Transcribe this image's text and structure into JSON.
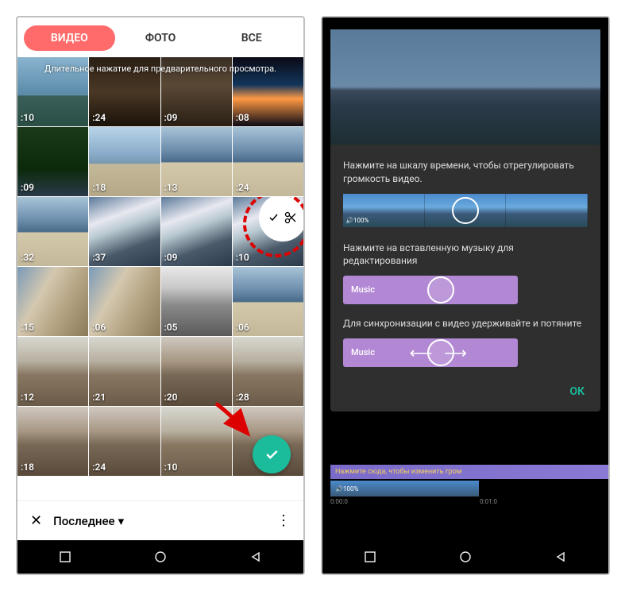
{
  "left": {
    "tabs": {
      "video": "ВИДЕО",
      "photo": "ФОТО",
      "all": "ВСЕ"
    },
    "hint": "Длительное нажатие для предварительного просмотра.",
    "cells": [
      {
        "dur": ":10",
        "cls": "sky1"
      },
      {
        "dur": ":24",
        "cls": "indoor"
      },
      {
        "dur": ":09",
        "cls": "indoor2"
      },
      {
        "dur": ":08",
        "cls": "dark"
      },
      {
        "dur": ":09",
        "cls": "tree"
      },
      {
        "dur": ":18",
        "cls": "beach"
      },
      {
        "dur": ":13",
        "cls": "beach2"
      },
      {
        "dur": ":24",
        "cls": "beach2"
      },
      {
        "dur": ":32",
        "cls": "beach2"
      },
      {
        "dur": ":37",
        "cls": "wave"
      },
      {
        "dur": ":09",
        "cls": "wave"
      },
      {
        "dur": ":10",
        "cls": "wave"
      },
      {
        "dur": ":15",
        "cls": "light"
      },
      {
        "dur": ":06",
        "cls": "light"
      },
      {
        "dur": ":05",
        "cls": "street"
      },
      {
        "dur": ":06",
        "cls": "beach2"
      },
      {
        "dur": ":12",
        "cls": "crowd"
      },
      {
        "dur": ":21",
        "cls": "crowd"
      },
      {
        "dur": ":20",
        "cls": "crowd2"
      },
      {
        "dur": ":28",
        "cls": "crowd"
      },
      {
        "dur": ":18",
        "cls": "crowd2"
      },
      {
        "dur": ":24",
        "cls": "crowd2"
      },
      {
        "dur": ":10",
        "cls": "crowd"
      },
      {
        "dur": "",
        "cls": "crowd2"
      }
    ],
    "dropdown": "Последнее"
  },
  "right": {
    "tip1": "Нажмите на шкалу времени, чтобы отрегулировать громкость видео.",
    "tip2": "Нажмите на вставленную музыку для редактирования",
    "tip3": "Для синхронизации с видео удерживайте и потяните",
    "vol": "100%",
    "music": "Music",
    "ok": "ОК",
    "stripe": "Нажмите сюда, чтобы изменить гром",
    "volbar": "100%",
    "t0": "0:00:0",
    "t1": "0:01:0"
  }
}
